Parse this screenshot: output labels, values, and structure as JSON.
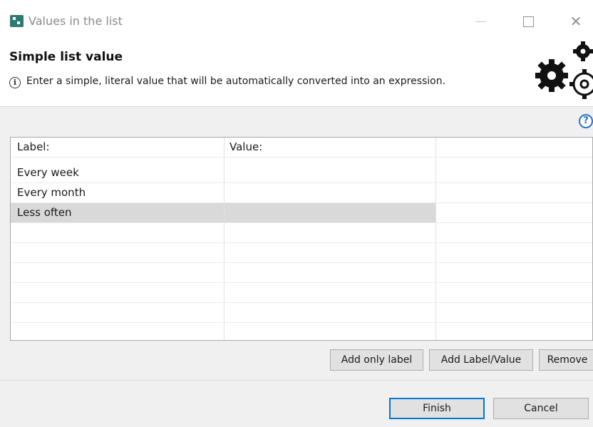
{
  "window": {
    "title": "Values in the list",
    "app_icon": "app-icon",
    "controls": [
      "minimize-icon",
      "maximize-icon",
      "close-icon"
    ],
    "close_glyph": "✕"
  },
  "header": {
    "title": "Simple list value",
    "description": "Enter a simple, literal value that will be automatically converted into an expression.",
    "info_glyph": "i",
    "decoration_icon": "gears-icon"
  },
  "help": {
    "glyph": "?"
  },
  "table": {
    "columns": [
      "Label:",
      "Value:",
      ""
    ],
    "rows": [
      {
        "label": "Every week",
        "value": "",
        "selected": false
      },
      {
        "label": "Every month",
        "value": "",
        "selected": false
      },
      {
        "label": "Less often",
        "value": "",
        "selected": true
      }
    ]
  },
  "list_buttons": {
    "add_only_label": "Add only label",
    "add_label_value": "Add Label/Value",
    "remove": "Remove"
  },
  "footer": {
    "finish": "Finish",
    "cancel": "Cancel"
  },
  "colors": {
    "accent": "#0078d7",
    "help": "#2b73c4",
    "selection": "#d9d9d9",
    "app_icon": "#2f7a72"
  }
}
